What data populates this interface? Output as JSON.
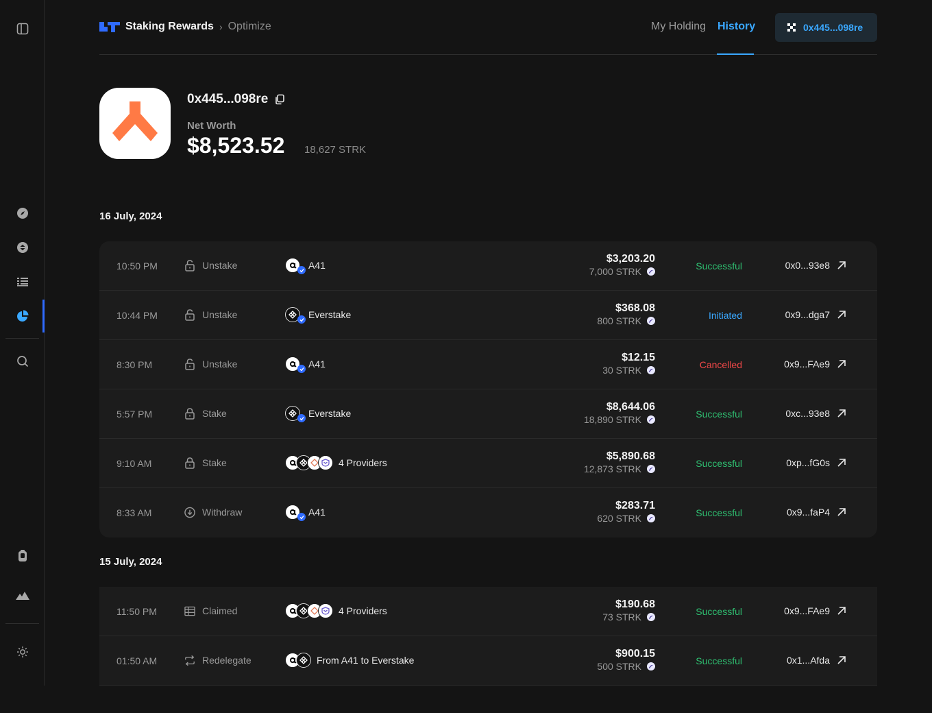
{
  "sidebar": {
    "icons": [
      "panel-toggle-icon",
      "compass-icon",
      "staking-icon",
      "list-icon",
      "pie-chart-icon",
      "search-icon",
      "wallet-icon",
      "mountain-icon",
      "sun-icon"
    ],
    "active": "pie-chart-icon"
  },
  "header": {
    "brand": "Staking Rewards",
    "breadcrumb_current": "Optimize",
    "nav": {
      "my_holding": "My Holding",
      "history": "History"
    },
    "wallet_label": "0x445...098re"
  },
  "profile": {
    "address": "0x445...098re",
    "net_worth_label": "Net Worth",
    "net_worth_value": "$8,523.52",
    "net_worth_strk": "18,627 STRK"
  },
  "colors": {
    "accent": "#3aa8ff",
    "success": "#2fbf71",
    "cancelled": "#f04848",
    "avatar_orange": "#ff7a45"
  },
  "groups": [
    {
      "date": "16 July, 2024",
      "rows": [
        {
          "time": "10:50 PM",
          "type": "Unstake",
          "type_icon": "lock-open-icon",
          "providers": [
            "a41"
          ],
          "provider_label": "A41",
          "usd": "$3,203.20",
          "strk": "7,000 STRK",
          "status": "Successful",
          "status_kind": "success",
          "tx": "0x0...93e8"
        },
        {
          "time": "10:44 PM",
          "type": "Unstake",
          "type_icon": "lock-open-icon",
          "providers": [
            "everstake"
          ],
          "provider_label": "Everstake",
          "usd": "$368.08",
          "strk": "800 STRK",
          "status": "Initiated",
          "status_kind": "initiated",
          "tx": "0x9...dga7"
        },
        {
          "time": "8:30 PM",
          "type": "Unstake",
          "type_icon": "lock-open-icon",
          "providers": [
            "a41"
          ],
          "provider_label": "A41",
          "usd": "$12.15",
          "strk": "30 STRK",
          "status": "Cancelled",
          "status_kind": "cancelled",
          "tx": "0x9...FAe9"
        },
        {
          "time": "5:57 PM",
          "type": "Stake",
          "type_icon": "lock-icon",
          "providers": [
            "everstake"
          ],
          "provider_label": "Everstake",
          "usd": "$8,644.06",
          "strk": "18,890 STRK",
          "status": "Successful",
          "status_kind": "success",
          "tx": "0xc...93e8"
        },
        {
          "time": "9:10 AM",
          "type": "Stake",
          "type_icon": "lock-icon",
          "providers": [
            "a41",
            "everstake",
            "p3",
            "p4"
          ],
          "provider_label": "4 Providers",
          "usd": "$5,890.68",
          "strk": "12,873 STRK",
          "status": "Successful",
          "status_kind": "success",
          "tx": "0xp...fG0s"
        },
        {
          "time": "8:33 AM",
          "type": "Withdraw",
          "type_icon": "withdraw-icon",
          "providers": [
            "a41"
          ],
          "provider_label": "A41",
          "usd": "$283.71",
          "strk": "620 STRK",
          "status": "Successful",
          "status_kind": "success",
          "tx": "0x9...faP4"
        }
      ]
    },
    {
      "date": "15 July, 2024",
      "rows": [
        {
          "time": "11:50 PM",
          "type": "Claimed",
          "type_icon": "claimed-icon",
          "providers": [
            "a41",
            "everstake",
            "p3",
            "p4"
          ],
          "provider_label": "4 Providers",
          "usd": "$190.68",
          "strk": "73 STRK",
          "status": "Successful",
          "status_kind": "success",
          "tx": "0x9...FAe9"
        },
        {
          "time": "01:50 AM",
          "type": "Redelegate",
          "type_icon": "redelegate-icon",
          "providers": [
            "a41",
            "everstake"
          ],
          "provider_label": "From A41 to Everstake",
          "usd": "$900.15",
          "strk": "500 STRK",
          "status": "Successful",
          "status_kind": "success",
          "tx": "0x1...Afda"
        }
      ]
    }
  ]
}
